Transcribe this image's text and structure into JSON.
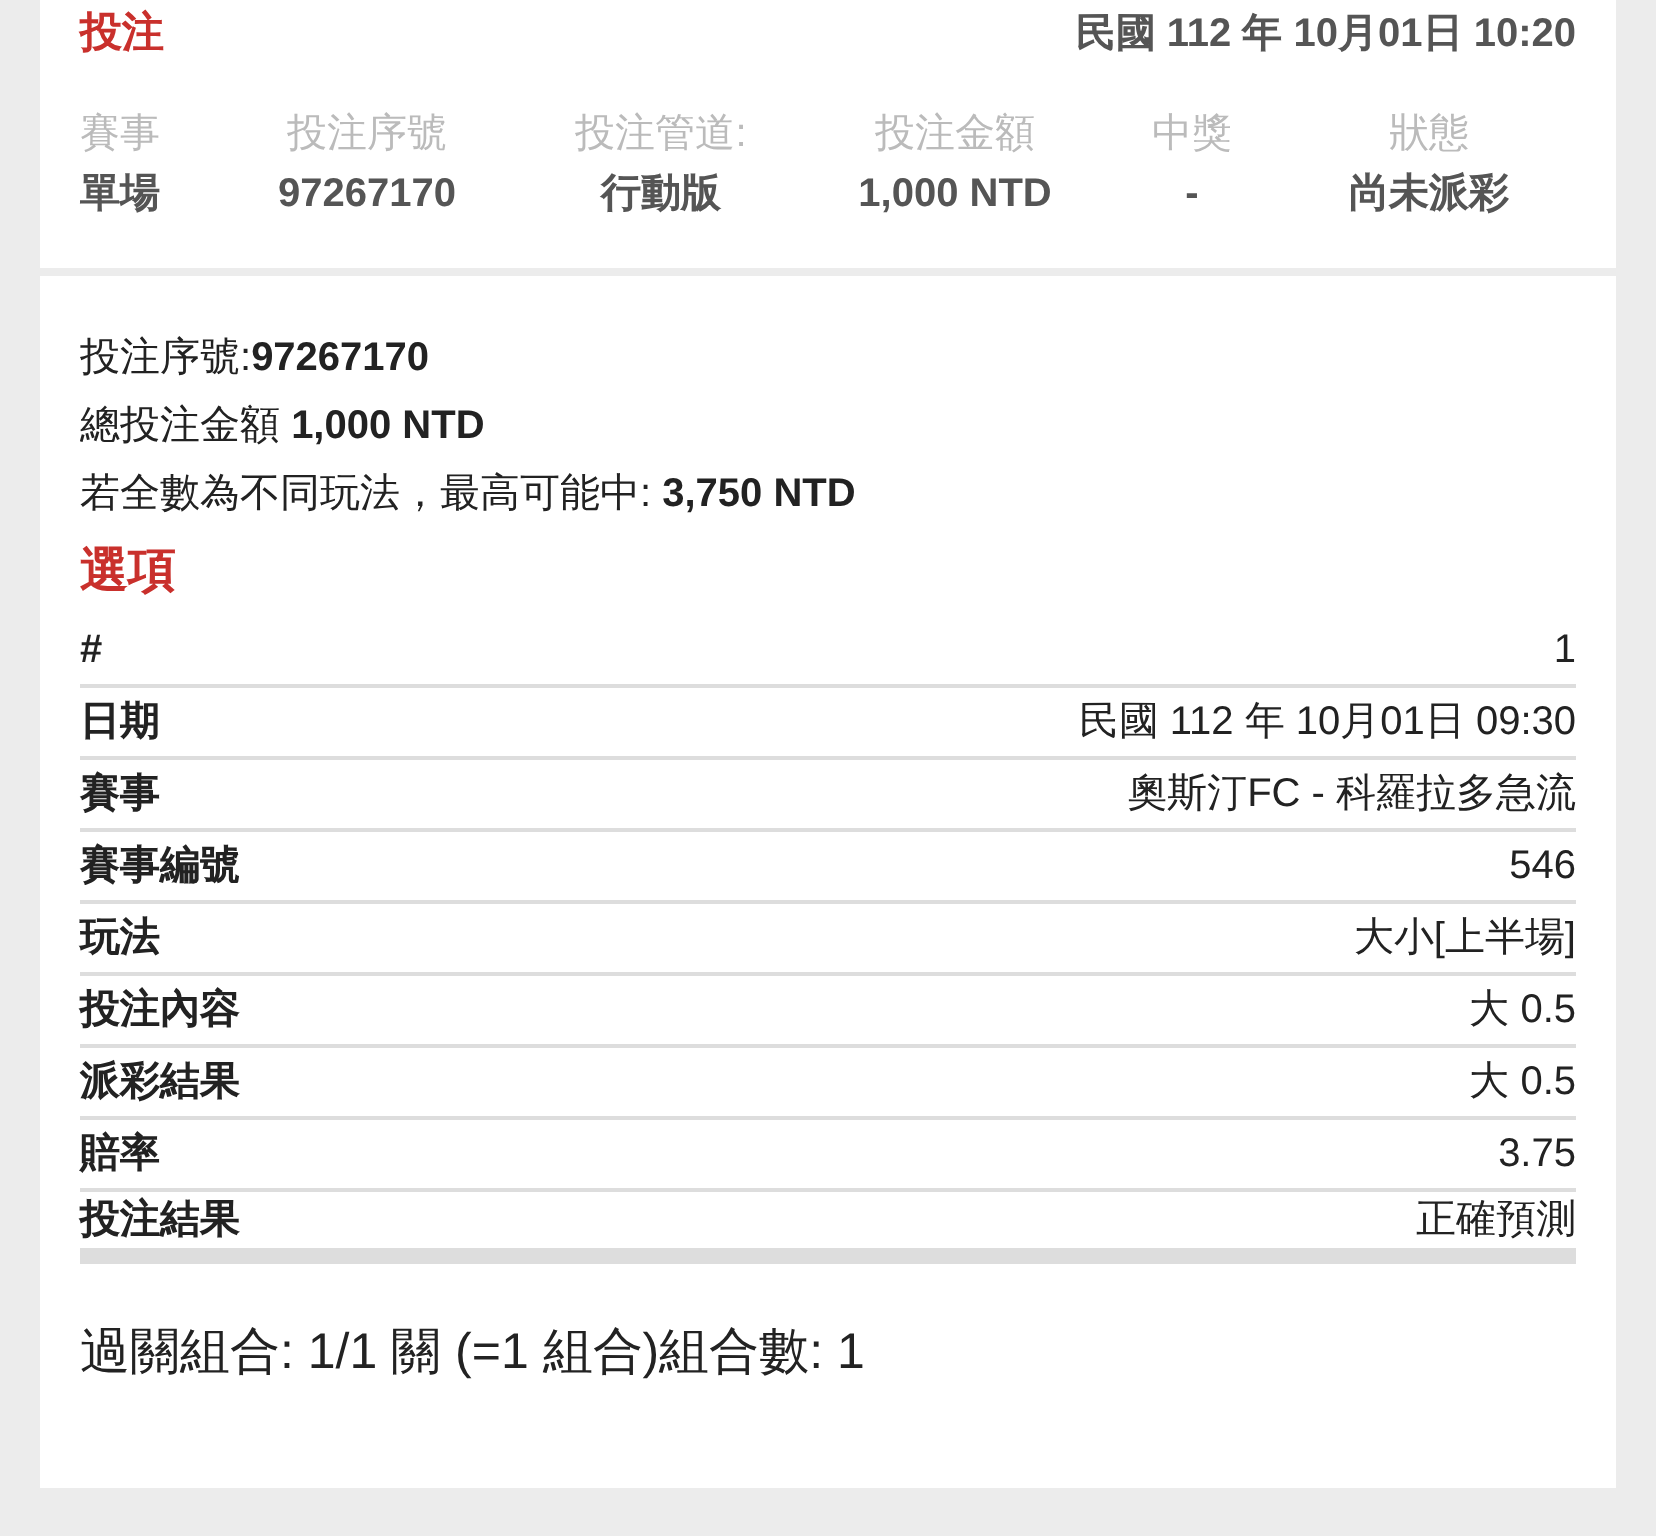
{
  "header": {
    "title": "投注",
    "datetime": "民國 112 年 10月01日 10:20"
  },
  "summary_table": {
    "columns": [
      "賽事",
      "投注序號",
      "投注管道:",
      "投注金額",
      "中獎",
      "狀態"
    ],
    "row": [
      "單場",
      "97267170",
      "行動版",
      "1,000 NTD",
      "-",
      "尚未派彩"
    ]
  },
  "details": [
    "投注序號:**97267170**",
    "總投注金額 **1,000 NTD**",
    "若全數為不同玩法，最高可能中: **3,750 NTD**"
  ],
  "options": {
    "title": "選項",
    "rows": [
      {
        "label": "#",
        "value": "1"
      },
      {
        "label": "日期",
        "value": "民國 112 年 10月01日 09:30"
      },
      {
        "label": "賽事",
        "value": "奧斯汀FC - 科羅拉多急流"
      },
      {
        "label": "賽事編號",
        "value": "546"
      },
      {
        "label": "玩法",
        "value": "大小[上半場]"
      },
      {
        "label": "投注內容",
        "value": "大 0.5"
      },
      {
        "label": "派彩結果",
        "value": "大 0.5"
      },
      {
        "label": "賠率",
        "value": "3.75"
      },
      {
        "label": "投注結果",
        "value": "正確預測"
      }
    ]
  },
  "combination": "過關組合: 1/1 關 (=1 組合)組合數: 1"
}
